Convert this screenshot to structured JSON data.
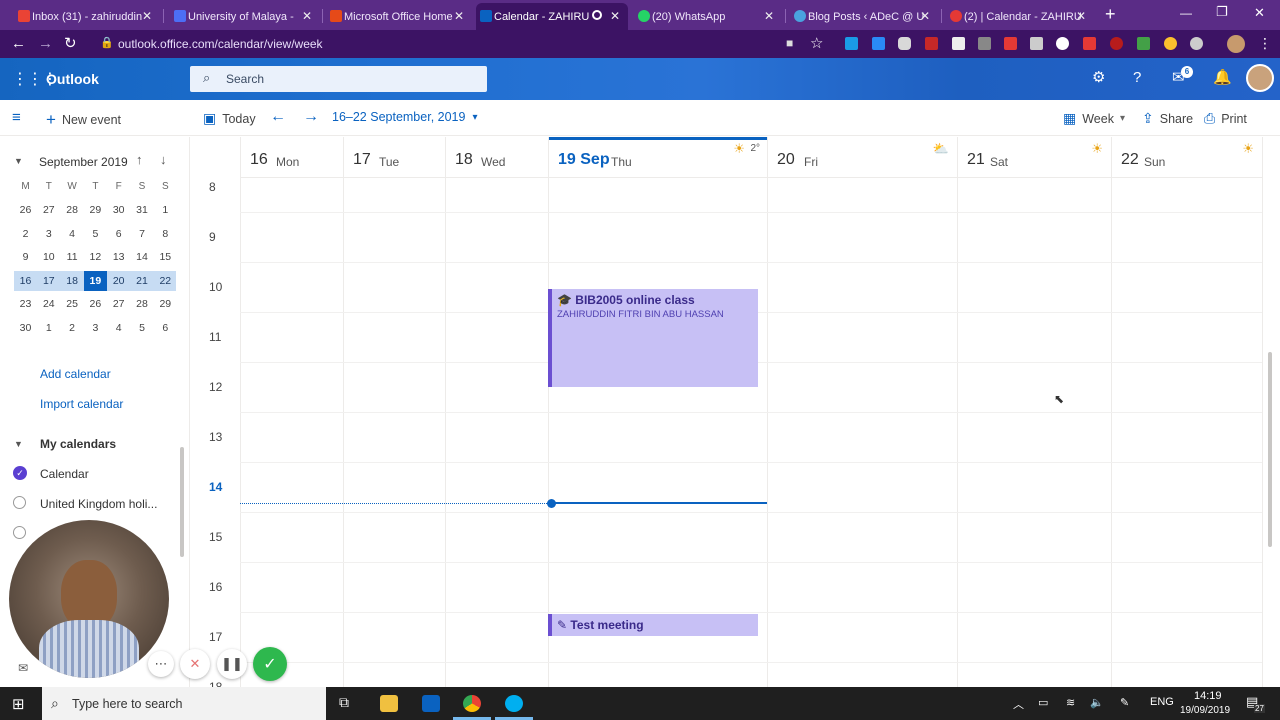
{
  "browser": {
    "tabs": [
      {
        "title": "Inbox (31) - zahiruddin",
        "fav_color": "#ea4335"
      },
      {
        "title": "University of Malaya -",
        "fav_color": "#4c6ef5"
      },
      {
        "title": "Microsoft Office Home",
        "fav_color": "#e64a19"
      },
      {
        "title": "Calendar - ZAHIRU",
        "fav_color": "#0a62c0",
        "active": true
      },
      {
        "title": "(20) WhatsApp",
        "fav_color": "#25d366"
      },
      {
        "title": "Blog Posts ‹ ADeC @ U",
        "fav_color": "#4aa3df"
      },
      {
        "title": "(2) | Calendar - ZAHIRU",
        "fav_color": "#e53935"
      }
    ],
    "url": "outlook.office.com/calendar/view/week"
  },
  "header": {
    "app_name": "Outlook",
    "search_placeholder": "Search",
    "notif_count": "6"
  },
  "toolbar": {
    "new_event": "New event",
    "today": "Today",
    "date_range": "16–22 September, 2019",
    "view": "Week",
    "share": "Share",
    "print": "Print"
  },
  "mini_calendar": {
    "title": "September 2019",
    "weekdays": [
      "M",
      "T",
      "W",
      "T",
      "F",
      "S",
      "S"
    ],
    "weeks": [
      [
        "26",
        "27",
        "28",
        "29",
        "30",
        "31",
        "1"
      ],
      [
        "2",
        "3",
        "4",
        "5",
        "6",
        "7",
        "8"
      ],
      [
        "9",
        "10",
        "11",
        "12",
        "13",
        "14",
        "15"
      ],
      [
        "16",
        "17",
        "18",
        "19",
        "20",
        "21",
        "22"
      ],
      [
        "23",
        "24",
        "25",
        "26",
        "27",
        "28",
        "29"
      ],
      [
        "30",
        "1",
        "2",
        "3",
        "4",
        "5",
        "6"
      ]
    ]
  },
  "leftnav": {
    "add_calendar": "Add calendar",
    "import_calendar": "Import calendar",
    "my_calendars": "My calendars",
    "calendar": "Calendar",
    "uk_holidays": "United Kingdom holi..."
  },
  "week": {
    "days": [
      {
        "num": "16",
        "name": "Mon"
      },
      {
        "num": "17",
        "name": "Tue"
      },
      {
        "num": "18",
        "name": "Wed"
      },
      {
        "num": "19 Sep",
        "name": "Thu",
        "today": true,
        "weather": "2°"
      },
      {
        "num": "20",
        "name": "Fri"
      },
      {
        "num": "21",
        "name": "Sat"
      },
      {
        "num": "22",
        "name": "Sun"
      }
    ],
    "hours": [
      "8",
      "9",
      "10",
      "11",
      "12",
      "13",
      "14",
      "15",
      "16",
      "17",
      "18"
    ],
    "events": [
      {
        "title": "BIB2005 online class",
        "organizer": "ZAHIRUDDIN FITRI BIN ABU HASSAN"
      },
      {
        "title": "Test meeting"
      }
    ]
  },
  "taskbar": {
    "search_placeholder": "Type here to search",
    "lang": "ENG",
    "time": "14:19",
    "date": "19/09/2019",
    "notif": "27"
  }
}
